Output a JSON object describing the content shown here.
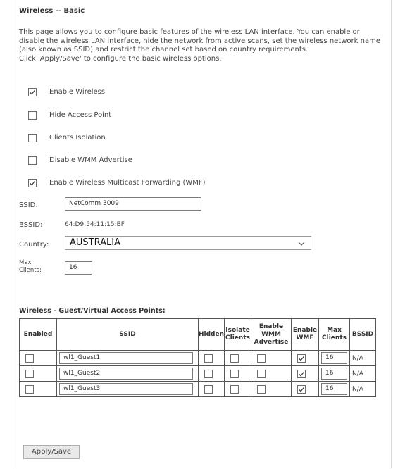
{
  "page": {
    "title": "Wireless -- Basic",
    "description": [
      "This page allows you to configure basic features of the wireless LAN interface. You can enable or disable the wireless LAN interface, hide the network from active scans, set the wireless network name (also known as SSID) and restrict the channel set based on country requirements.",
      "Click 'Apply/Save' to configure the basic wireless options."
    ]
  },
  "options": [
    {
      "label": "Enable Wireless",
      "checked": true
    },
    {
      "label": "Hide Access Point",
      "checked": false
    },
    {
      "label": "Clients Isolation",
      "checked": false
    },
    {
      "label": "Disable WMM Advertise",
      "checked": false
    },
    {
      "label": "Enable Wireless Multicast Forwarding (WMF)",
      "checked": true
    }
  ],
  "fields": {
    "ssid_label": "SSID:",
    "ssid_value": "NetComm 3009",
    "bssid_label": "BSSID:",
    "bssid_value": "64:D9:54:11:15:BF",
    "country_label": "Country:",
    "country_value": "AUSTRALIA",
    "max_clients_label_1": "Max",
    "max_clients_label_2": "Clients:",
    "max_clients_value": "16"
  },
  "guest": {
    "title": "Wireless - Guest/Virtual Access Points:",
    "headers": {
      "enabled": "Enabled",
      "ssid": "SSID",
      "hidden": "Hidden",
      "isolate_1": "Isolate",
      "isolate_2": "Clients",
      "wmm_1": "Enable",
      "wmm_2": "WMM",
      "wmm_3": "Advertise",
      "wmf_1": "Enable",
      "wmf_2": "WMF",
      "max_1": "Max",
      "max_2": "Clients",
      "bssid": "BSSID"
    },
    "rows": [
      {
        "enabled": false,
        "ssid": "wl1_Guest1",
        "hidden": false,
        "isolate": false,
        "wmm": false,
        "wmf": true,
        "max": "16",
        "bssid": "N/A"
      },
      {
        "enabled": false,
        "ssid": "wl1_Guest2",
        "hidden": false,
        "isolate": false,
        "wmm": false,
        "wmf": true,
        "max": "16",
        "bssid": "N/A"
      },
      {
        "enabled": false,
        "ssid": "wl1_Guest3",
        "hidden": false,
        "isolate": false,
        "wmm": false,
        "wmf": true,
        "max": "16",
        "bssid": "N/A"
      }
    ]
  },
  "actions": {
    "apply_label": "Apply/Save"
  },
  "icons": {
    "checkbox_checked": "checkmark-icon",
    "select_chevron": "chevron-down-icon"
  }
}
